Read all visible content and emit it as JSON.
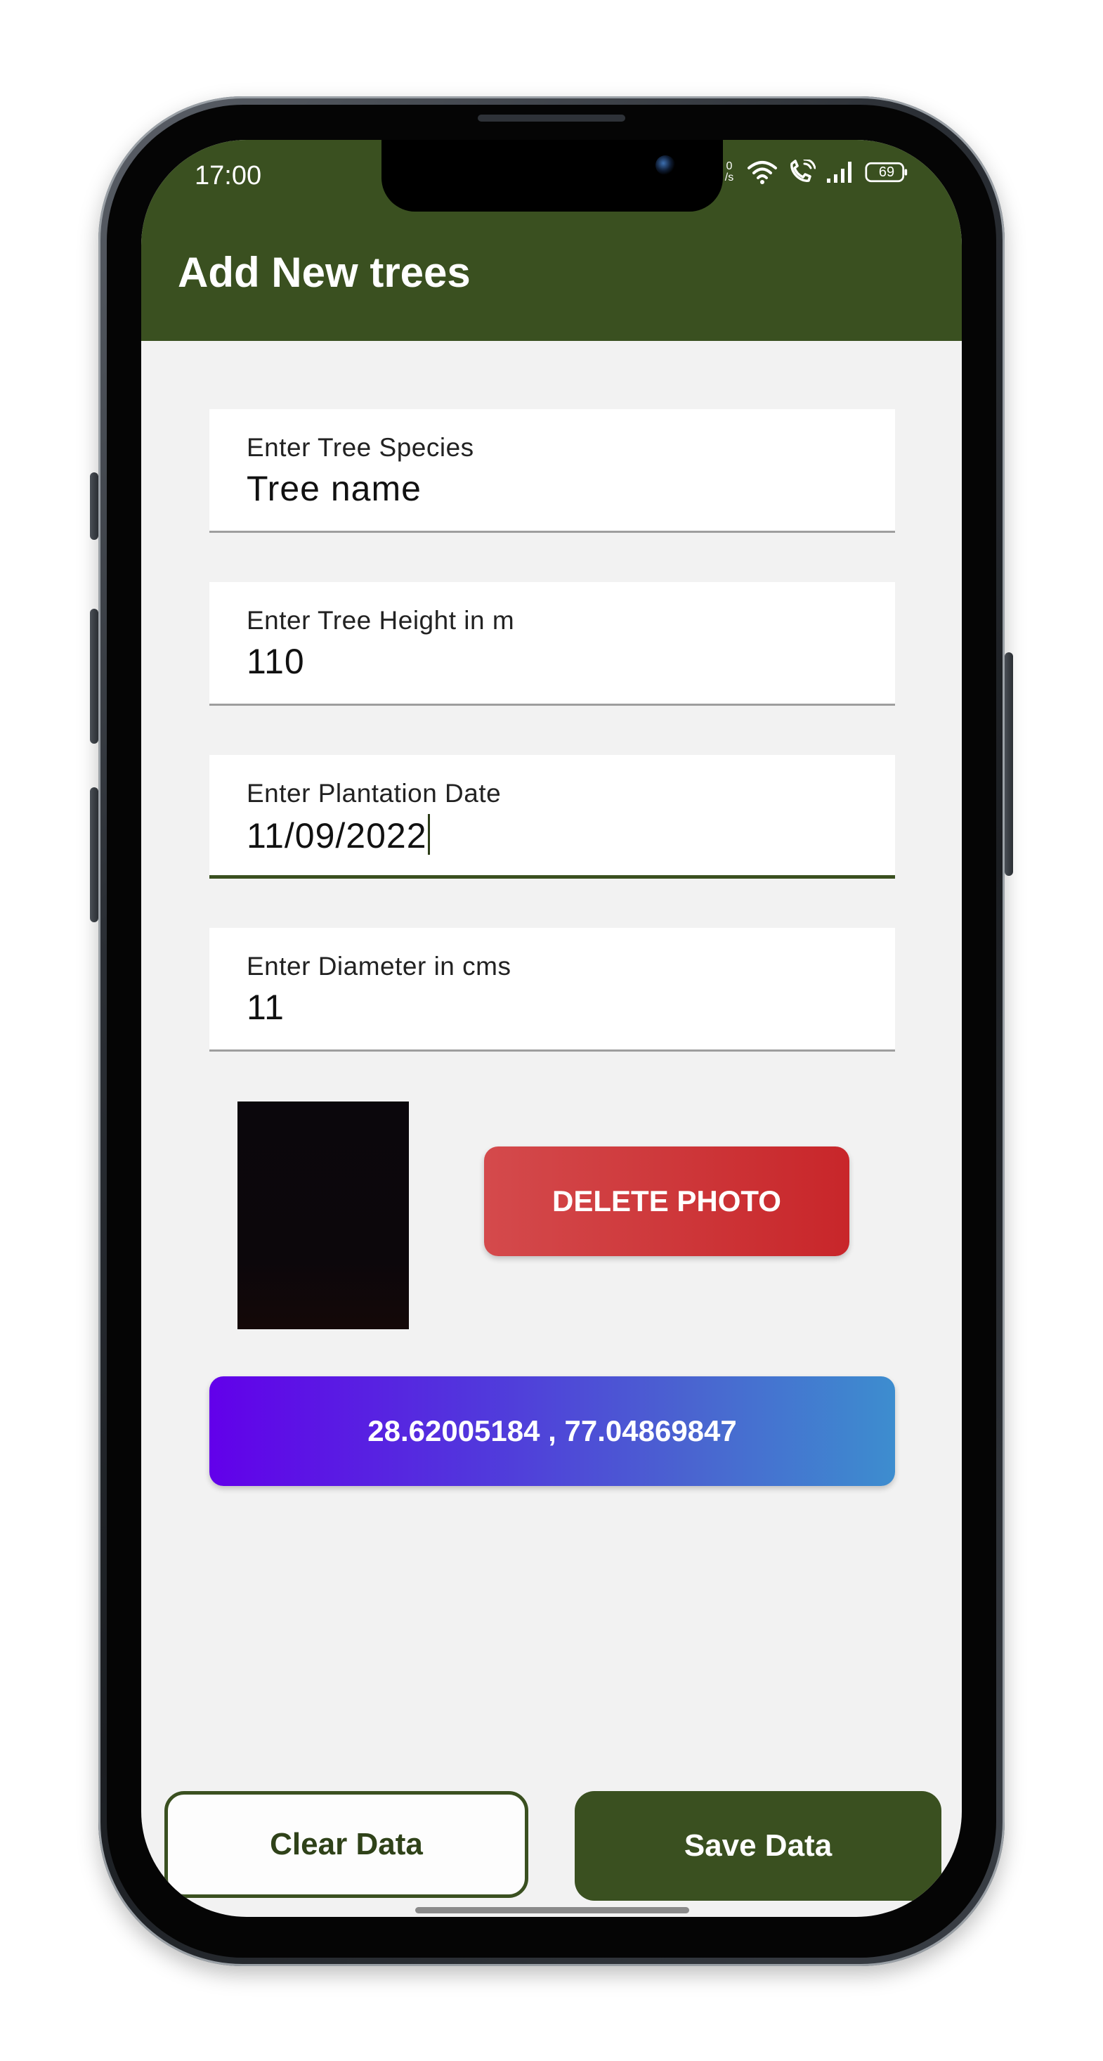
{
  "status_bar": {
    "time": "17:00",
    "net_speed_top": "0",
    "net_speed_bottom": "/s",
    "battery_level": "69"
  },
  "app_bar": {
    "title": "Add New trees"
  },
  "form": {
    "species": {
      "label": "Enter Tree Species",
      "value": "Tree name"
    },
    "height": {
      "label": "Enter Tree Height in m",
      "value": "110"
    },
    "plantation_date": {
      "label": "Enter Plantation Date",
      "value": "11/09/2022"
    },
    "diameter": {
      "label": "Enter Diameter in cms",
      "value": "11"
    }
  },
  "photo": {
    "delete_label": "DELETE PHOTO"
  },
  "location": {
    "coordinates": "28.62005184 , 77.04869847"
  },
  "actions": {
    "clear_label": "Clear Data",
    "save_label": "Save Data"
  },
  "colors": {
    "primary": "#3a5020",
    "delete": "#cf3436",
    "location_start": "#6200ea",
    "location_end": "#3d8dcf",
    "background": "#f2f2f2"
  }
}
